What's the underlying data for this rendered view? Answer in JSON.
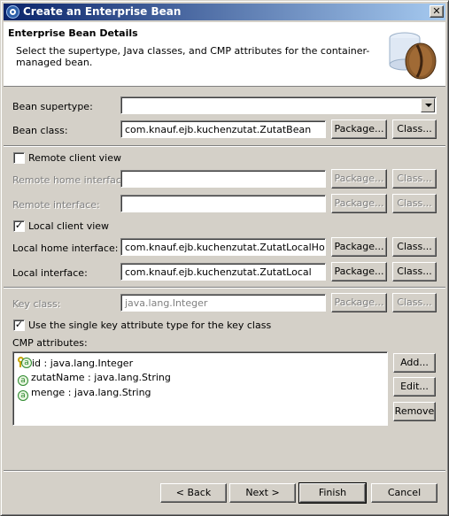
{
  "window": {
    "title": "Create an Enterprise Bean",
    "close_label": "✕"
  },
  "header": {
    "title": "Enterprise Bean Details",
    "description": "Select the supertype, Java classes, and CMP attributes for the container-managed bean."
  },
  "form": {
    "bean_supertype": {
      "label": "Bean supertype:",
      "value": ""
    },
    "bean_class": {
      "label": "Bean class:",
      "value": "com.knauf.ejb.kuchenzutat.ZutatBean",
      "package_label": "Package...",
      "class_label": "Class..."
    },
    "remote_client_view": {
      "label": "Remote client view",
      "checked": false
    },
    "remote_home_interface": {
      "label": "Remote home interface:",
      "value": "",
      "package_label": "Package...",
      "class_label": "Class..."
    },
    "remote_interface": {
      "label": "Remote interface:",
      "value": "",
      "package_label": "Package...",
      "class_label": "Class..."
    },
    "local_client_view": {
      "label": "Local client view",
      "checked": true
    },
    "local_home_interface": {
      "label": "Local home interface:",
      "value": "com.knauf.ejb.kuchenzutat.ZutatLocalHome",
      "package_label": "Package...",
      "class_label": "Class..."
    },
    "local_interface": {
      "label": "Local interface:",
      "value": "com.knauf.ejb.kuchenzutat.ZutatLocal",
      "package_label": "Package...",
      "class_label": "Class..."
    },
    "key_class": {
      "label": "Key class:",
      "value": "java.lang.Integer",
      "package_label": "Package...",
      "class_label": "Class..."
    },
    "single_key": {
      "label": "Use the single key attribute type for the key class",
      "checked": true
    }
  },
  "cmp": {
    "label": "CMP attributes:",
    "items": [
      {
        "text": "id : java.lang.Integer",
        "icon": "key-attribute-icon"
      },
      {
        "text": "zutatName : java.lang.String",
        "icon": "attribute-icon"
      },
      {
        "text": "menge : java.lang.String",
        "icon": "attribute-icon"
      }
    ],
    "add_label": "Add...",
    "edit_label": "Edit...",
    "remove_label": "Remove"
  },
  "footer": {
    "back_label": "< Back",
    "next_label": "Next >",
    "finish_label": "Finish",
    "cancel_label": "Cancel"
  },
  "check_glyph": "✓",
  "attr_glyph": "a"
}
